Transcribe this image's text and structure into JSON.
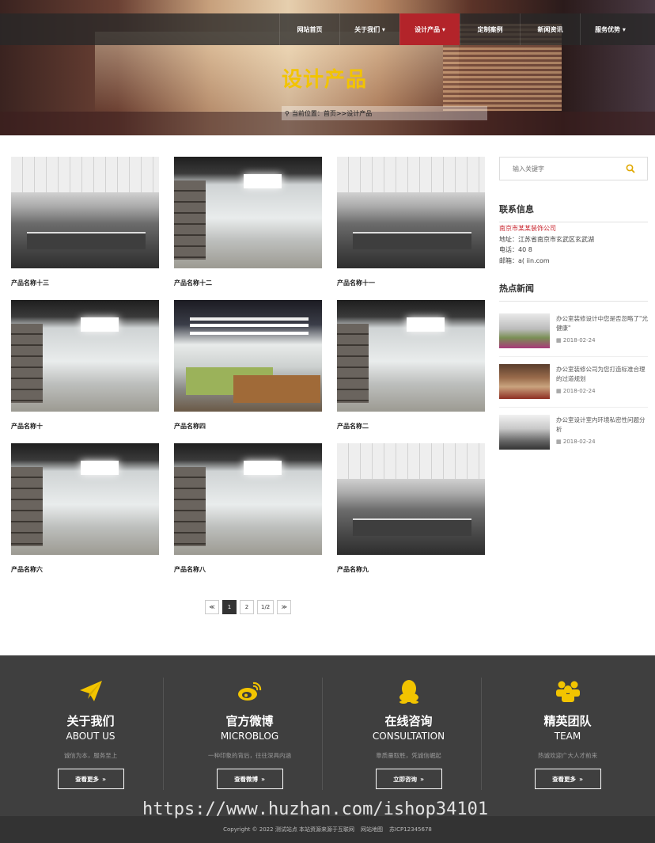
{
  "nav": {
    "items": [
      {
        "label": "网站首页"
      },
      {
        "label": "关于我们 ▾"
      },
      {
        "label": "设计产品 ▾"
      },
      {
        "label": "定制案例"
      },
      {
        "label": "新闻资讯"
      },
      {
        "label": "服务优势 ▾"
      }
    ],
    "active_index": 2
  },
  "banner": {
    "title": "设计产品",
    "breadcrumb": "当前位置：首页>>设计产品"
  },
  "products": [
    {
      "name": "产品名称十三",
      "style": "office-a"
    },
    {
      "name": "产品名称十二",
      "style": "office-b"
    },
    {
      "name": "产品名称十一",
      "style": "office-a"
    },
    {
      "name": "产品名称十",
      "style": "office-b"
    },
    {
      "name": "产品名称四",
      "style": "office-c"
    },
    {
      "name": "产品名称二",
      "style": "office-b"
    },
    {
      "name": "产品名称六",
      "style": "office-b"
    },
    {
      "name": "产品名称八",
      "style": "office-b"
    },
    {
      "name": "产品名称九",
      "style": "office-a"
    }
  ],
  "pagination": {
    "prev": "≪",
    "pages": [
      "1",
      "2"
    ],
    "current": "1",
    "summary": "1/2",
    "next": "≫"
  },
  "sidebar": {
    "search_placeholder": "输入关键字",
    "contact_heading": "联系信息",
    "company": "南京市某某装饰公司",
    "address": "地址：江苏省南京市玄武区玄武湖",
    "phone": "电话：40                8",
    "email": "邮箱：a(                iin.com",
    "news_heading": "热点新闻",
    "news": [
      {
        "title": "办公室装修设计中您是否忽略了\"光健康\"",
        "date": "2018-02-24"
      },
      {
        "title": "办公室装修公司为您打造标准合理的过道规划",
        "date": "2018-02-24"
      },
      {
        "title": "办公室设计室内环境私密性问题分析",
        "date": "2018-02-24"
      }
    ]
  },
  "footer": {
    "columns": [
      {
        "title": "关于我们",
        "en": "ABOUT US",
        "desc": "诚信为本，服务至上",
        "button": "查看更多",
        "icon": "paper-plane-icon"
      },
      {
        "title": "官方微博",
        "en": "MICROBLOG",
        "desc": "一种印象的背后，往往深具内涵",
        "button": "查看微博",
        "icon": "weibo-icon"
      },
      {
        "title": "在线咨询",
        "en": "CONSULTATION",
        "desc": "靠质量取胜，凭诚信崛起",
        "button": "立即咨询",
        "icon": "qq-icon"
      },
      {
        "title": "精英团队",
        "en": "TEAM",
        "desc": "热诚欢迎广大人才前来",
        "button": "查看更多",
        "icon": "team-icon"
      }
    ],
    "copyright": "Copyright © 2022 测试站点 本站资源来源于互联网",
    "sitemap": "网站地图",
    "icp": "苏ICP12345678",
    "watermark": "https://www.huzhan.com/ishop34101"
  },
  "colors": {
    "accent": "#b3242a",
    "title_yellow": "#f2c400",
    "icon_yellow": "#f2c400",
    "footer_bg": "#3f3f3f"
  }
}
